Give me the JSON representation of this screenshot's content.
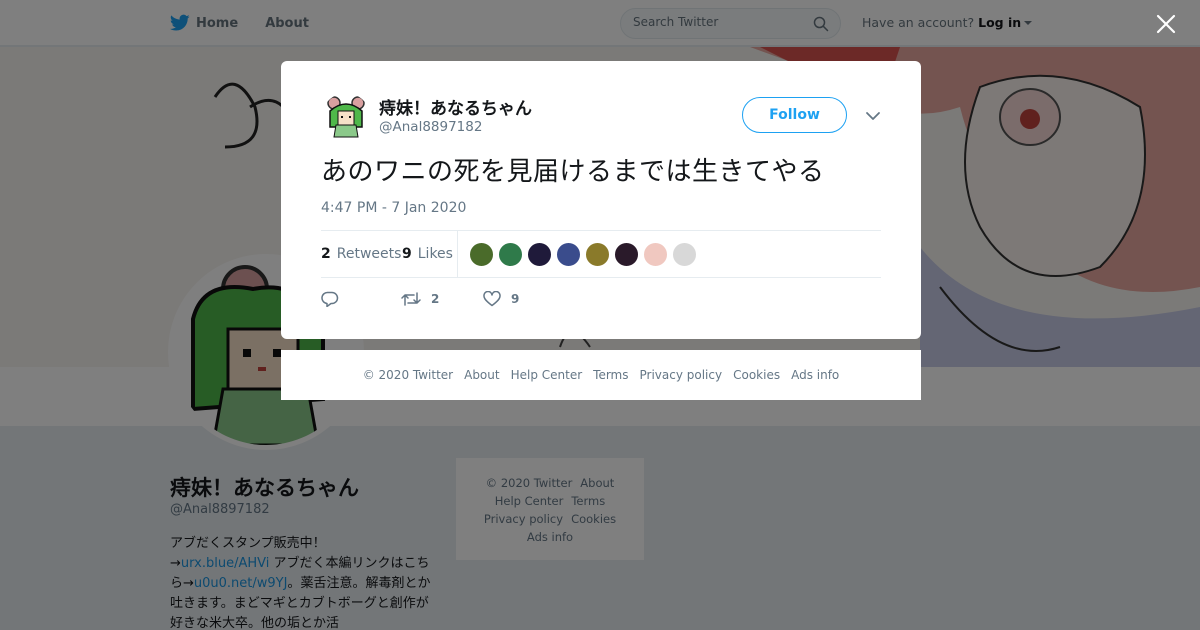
{
  "nav": {
    "home_label": "Home",
    "about_label": "About",
    "search_placeholder": "Search Twitter",
    "account_prompt": "Have an account?",
    "login_label": "Log in"
  },
  "profile": {
    "name": "痔妹！あなるちゃん",
    "handle": "@Anal8897182",
    "bio_line1": "アブだくスタンプ販売中！",
    "bio_link1": "urx.blue/AHVi",
    "bio_mid": " アブだく本編リンクはこちら→",
    "bio_link2": "u0u0.net/w9YJ",
    "bio_end": "。薬舌注意。解毒剤とか吐きます。まどマギとカブトボーグと創作が好きな米大卒。他の垢とか活",
    "arrow": "→"
  },
  "side_footer": {
    "copyright": "© 2020 Twitter",
    "about": "About",
    "help": "Help Center",
    "terms": "Terms",
    "privacy": "Privacy policy",
    "cookies": "Cookies",
    "ads": "Ads info"
  },
  "tweet": {
    "name": "痔妹！あなるちゃん",
    "handle": "@Anal8897182",
    "follow_label": "Follow",
    "text": "あのワニの死を見届けるまでは生きてやる",
    "timestamp": "4:47 PM - 7 Jan 2020",
    "retweets_count": "2",
    "retweets_label": "Retweets",
    "likes_count": "9",
    "likes_label": "Likes",
    "reply_count": "",
    "retweet_action_count": "2",
    "like_action_count": "9",
    "liker_colors": [
      "#4a6b2a",
      "#2f7a4a",
      "#1f1a3a",
      "#3a4c8c",
      "#8a7a2a",
      "#2a1a2a",
      "#f0c8c0",
      "#d8d8d8"
    ]
  },
  "modal_footer": {
    "copyright": "© 2020 Twitter",
    "about": "About",
    "help": "Help Center",
    "terms": "Terms",
    "privacy": "Privacy policy",
    "cookies": "Cookies",
    "ads": "Ads info"
  },
  "colors": {
    "brand": "#1da1f2",
    "link": "#1b95e0",
    "muted": "#657786"
  }
}
